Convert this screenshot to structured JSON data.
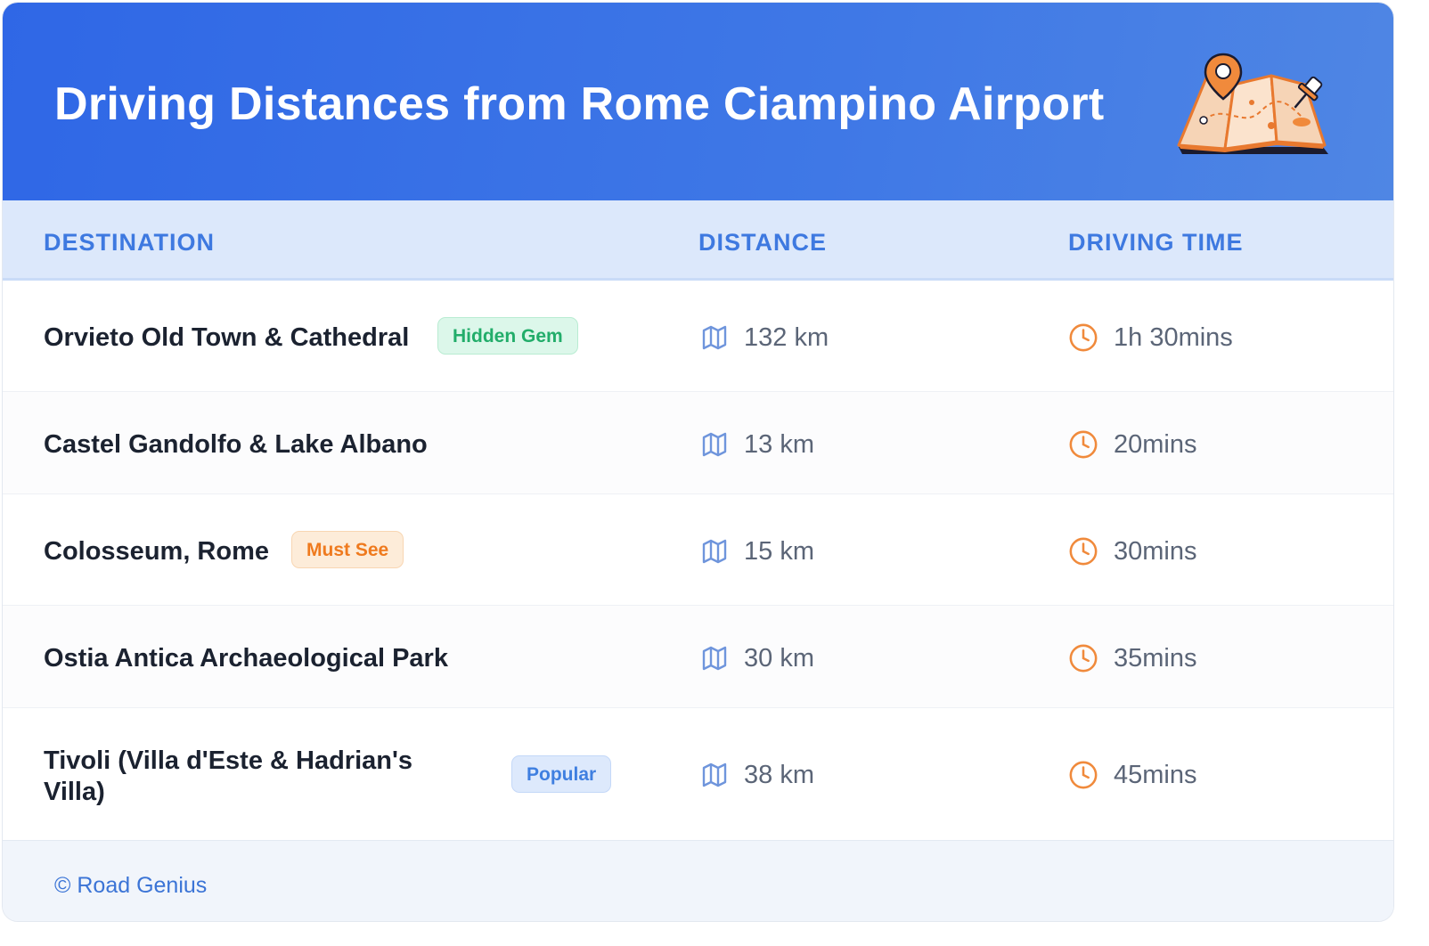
{
  "header": {
    "title": "Driving Distances from Rome Ciampino Airport",
    "illustration": "folded-map-with-pins-icon"
  },
  "table": {
    "columns": [
      "DESTINATION",
      "DISTANCE",
      "DRIVING TIME"
    ],
    "distance_icon": "map-icon",
    "time_icon": "clock-icon",
    "rows": [
      {
        "destination": "Orvieto Old Town & Cathedral",
        "badge": "Hidden Gem",
        "badge_color": "#22ad6a",
        "distance": "132 km",
        "time": "1h 30mins"
      },
      {
        "destination": "Castel Gandolfo & Lake Albano",
        "badge": "",
        "distance": "13 km",
        "time": "20mins"
      },
      {
        "destination": "Colosseum, Rome",
        "badge": "Must See",
        "badge_color": "#ef7a1e",
        "distance": "15 km",
        "time": "30mins"
      },
      {
        "destination": "Ostia Antica Archaeological Park",
        "badge": "",
        "distance": "30 km",
        "time": "35mins"
      },
      {
        "destination": "Tivoli (Villa d'Este & Hadrian's Villa)",
        "badge": "Popular",
        "badge_color": "#3f7fe0",
        "distance": "38 km",
        "time": "45mins"
      }
    ]
  },
  "footer": {
    "text": "© Road Genius"
  },
  "colors": {
    "header_gradient_start": "#2f67e6",
    "header_gradient_end": "#4f86e4",
    "accent_blue": "#3e79e0",
    "accent_orange": "#f08a3c"
  }
}
